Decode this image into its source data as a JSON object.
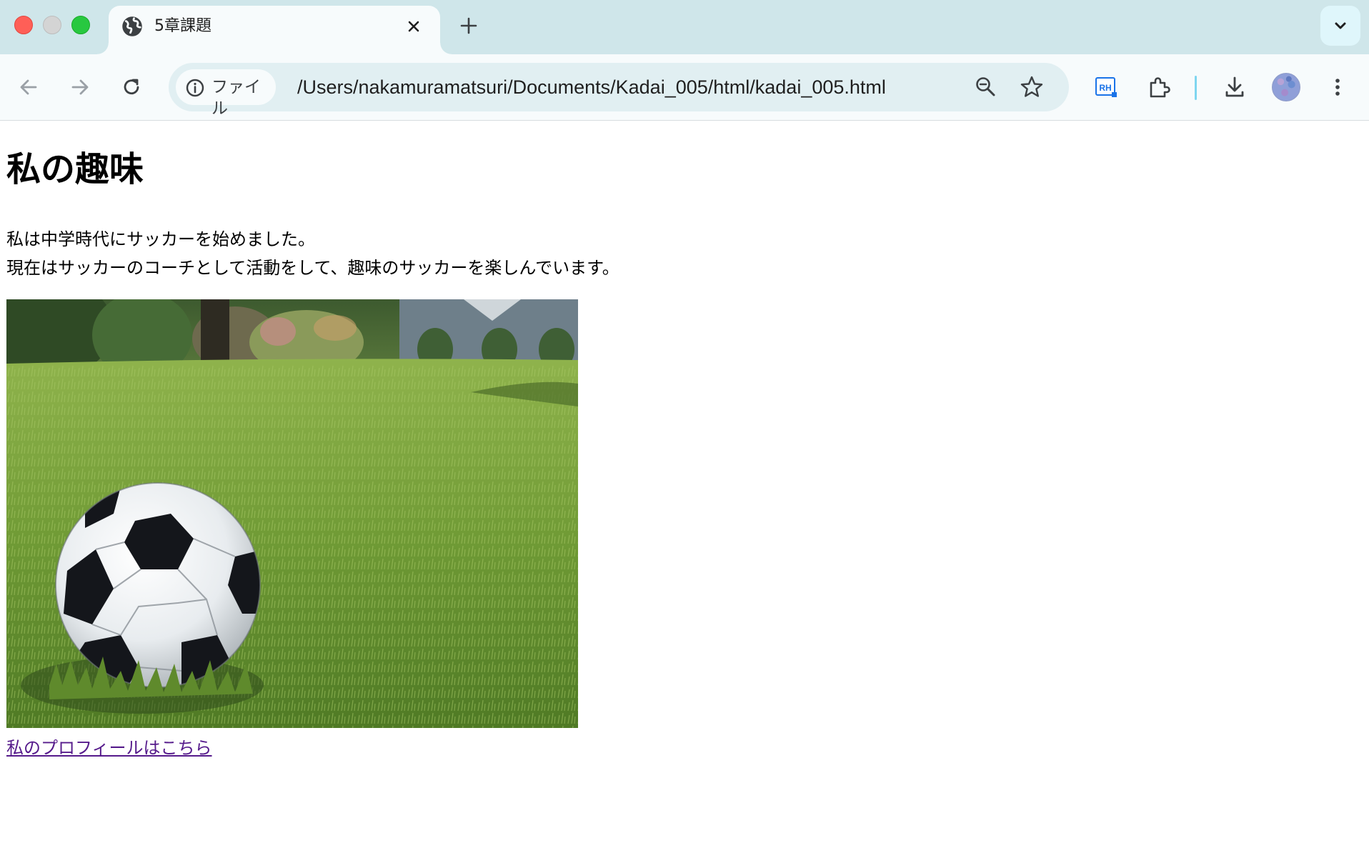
{
  "browser": {
    "tab": {
      "title": "5章課題",
      "favicon": "globe-icon"
    },
    "address_bar": {
      "security_chip_label": "ファイル",
      "url": "/Users/nakamuramatsuri/Documents/Kadai_005/html/kadai_005.html"
    },
    "icons": [
      "back-arrow-icon",
      "forward-arrow-icon",
      "reload-icon",
      "info-icon",
      "zoom-out-icon",
      "bookmark-star-icon",
      "rh-extension-icon",
      "extensions-puzzle-icon",
      "download-icon",
      "profile-avatar",
      "more-vert-icon",
      "new-tab-plus-icon",
      "tab-search-chevron-icon",
      "close-icon"
    ]
  },
  "page": {
    "heading": "私の趣味",
    "paragraph_lines": [
      "私は中学時代にサッカーを始めました。",
      "現在はサッカーのコーチとして活動をして、趣味のサッカーを楽しんでいます。"
    ],
    "image": "soccer ball on grass photo",
    "link_text": "私のプロフィールはこちら"
  },
  "colors": {
    "tabstrip_bg": "#cfe6ea",
    "toolbar_bg": "#f7fbfc",
    "omnibox_bg": "#e1eff2",
    "visited_link": "#551a8b"
  }
}
